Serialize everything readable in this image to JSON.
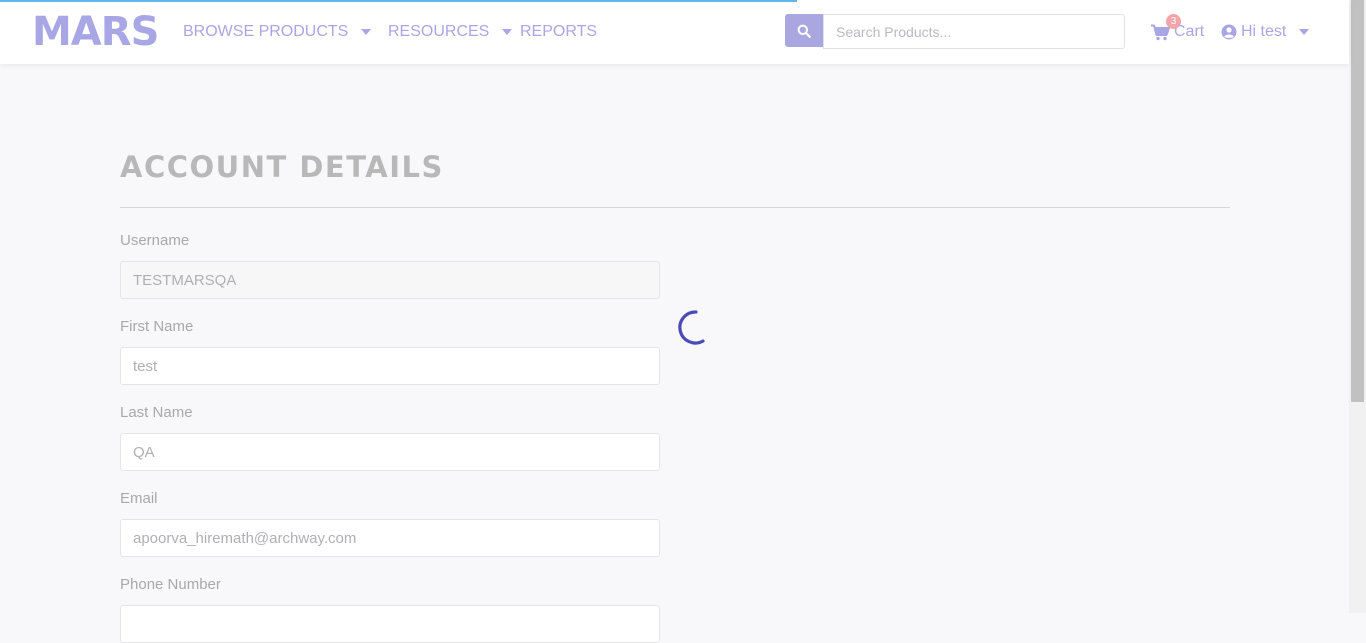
{
  "navbar": {
    "logo": "MARS",
    "items": [
      {
        "label": "BROWSE PRODUCTS",
        "has_dropdown": true
      },
      {
        "label": "RESOURCES",
        "has_dropdown": true
      },
      {
        "label": "REPORTS",
        "has_dropdown": false
      }
    ],
    "search": {
      "placeholder": "Search Products...",
      "value": "",
      "icon": "search-icon"
    },
    "cart": {
      "label": "Cart",
      "badge": "3",
      "icon": "cart-icon"
    },
    "user": {
      "label": "Hi test",
      "icon": "user-circle-icon"
    }
  },
  "page": {
    "title": "ACCOUNT DETAILS",
    "fields": [
      {
        "label": "Username",
        "value": "TESTMARSQA",
        "readonly": true
      },
      {
        "label": "First Name",
        "value": "test"
      },
      {
        "label": "Last Name",
        "value": "QA"
      },
      {
        "label": "Email",
        "value": "apoorva_hiremath@archway.com"
      },
      {
        "label": "Phone Number",
        "value": ""
      }
    ]
  },
  "status": {
    "loading": true
  },
  "colors": {
    "brand": "#a9a6e6",
    "spinner": "#4b4bb8",
    "progress": "#5fb8e8",
    "badge": "#f4a3a8"
  }
}
